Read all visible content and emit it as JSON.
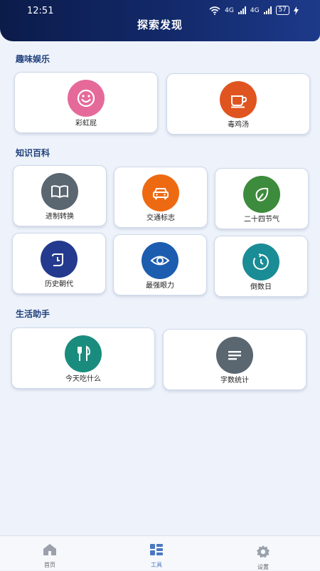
{
  "status_bar": {
    "time": "12:51",
    "network_1": "4G",
    "network_2": "4G",
    "battery": "57"
  },
  "header": {
    "title": "探索发现"
  },
  "sections": {
    "fun": {
      "title": "趣味娱乐",
      "items": [
        {
          "label": "彩虹屁",
          "icon": "smile-face-icon",
          "color": "#e56a9a"
        },
        {
          "label": "毒鸡汤",
          "icon": "coffee-cup-icon",
          "color": "#e0551f"
        }
      ]
    },
    "knowledge": {
      "title": "知识百科",
      "items": [
        {
          "label": "进制转换",
          "icon": "book-icon",
          "color": "#5a6670"
        },
        {
          "label": "交通标志",
          "icon": "car-icon",
          "color": "#ee6a12"
        },
        {
          "label": "二十四节气",
          "icon": "leaf-drop-icon",
          "color": "#3d8b3d"
        },
        {
          "label": "历史朝代",
          "icon": "history-scroll-icon",
          "color": "#233a8e"
        },
        {
          "label": "最强眼力",
          "icon": "eye-icon",
          "color": "#1c5db0"
        },
        {
          "label": "倒数日",
          "icon": "countdown-timer-icon",
          "color": "#1a8c95"
        }
      ]
    },
    "life": {
      "title": "生活助手",
      "items": [
        {
          "label": "今天吃什么",
          "icon": "fork-knife-icon",
          "color": "#1a8c7e"
        },
        {
          "label": "字数统计",
          "icon": "text-lines-icon",
          "color": "#5a6670"
        }
      ]
    }
  },
  "bottom_nav": {
    "active_color": "#4a78c2",
    "items": [
      {
        "label": "首页",
        "icon": "home-icon"
      },
      {
        "label": "工具",
        "icon": "tools-grid-icon"
      },
      {
        "label": "设置",
        "icon": "gear-icon"
      }
    ]
  }
}
